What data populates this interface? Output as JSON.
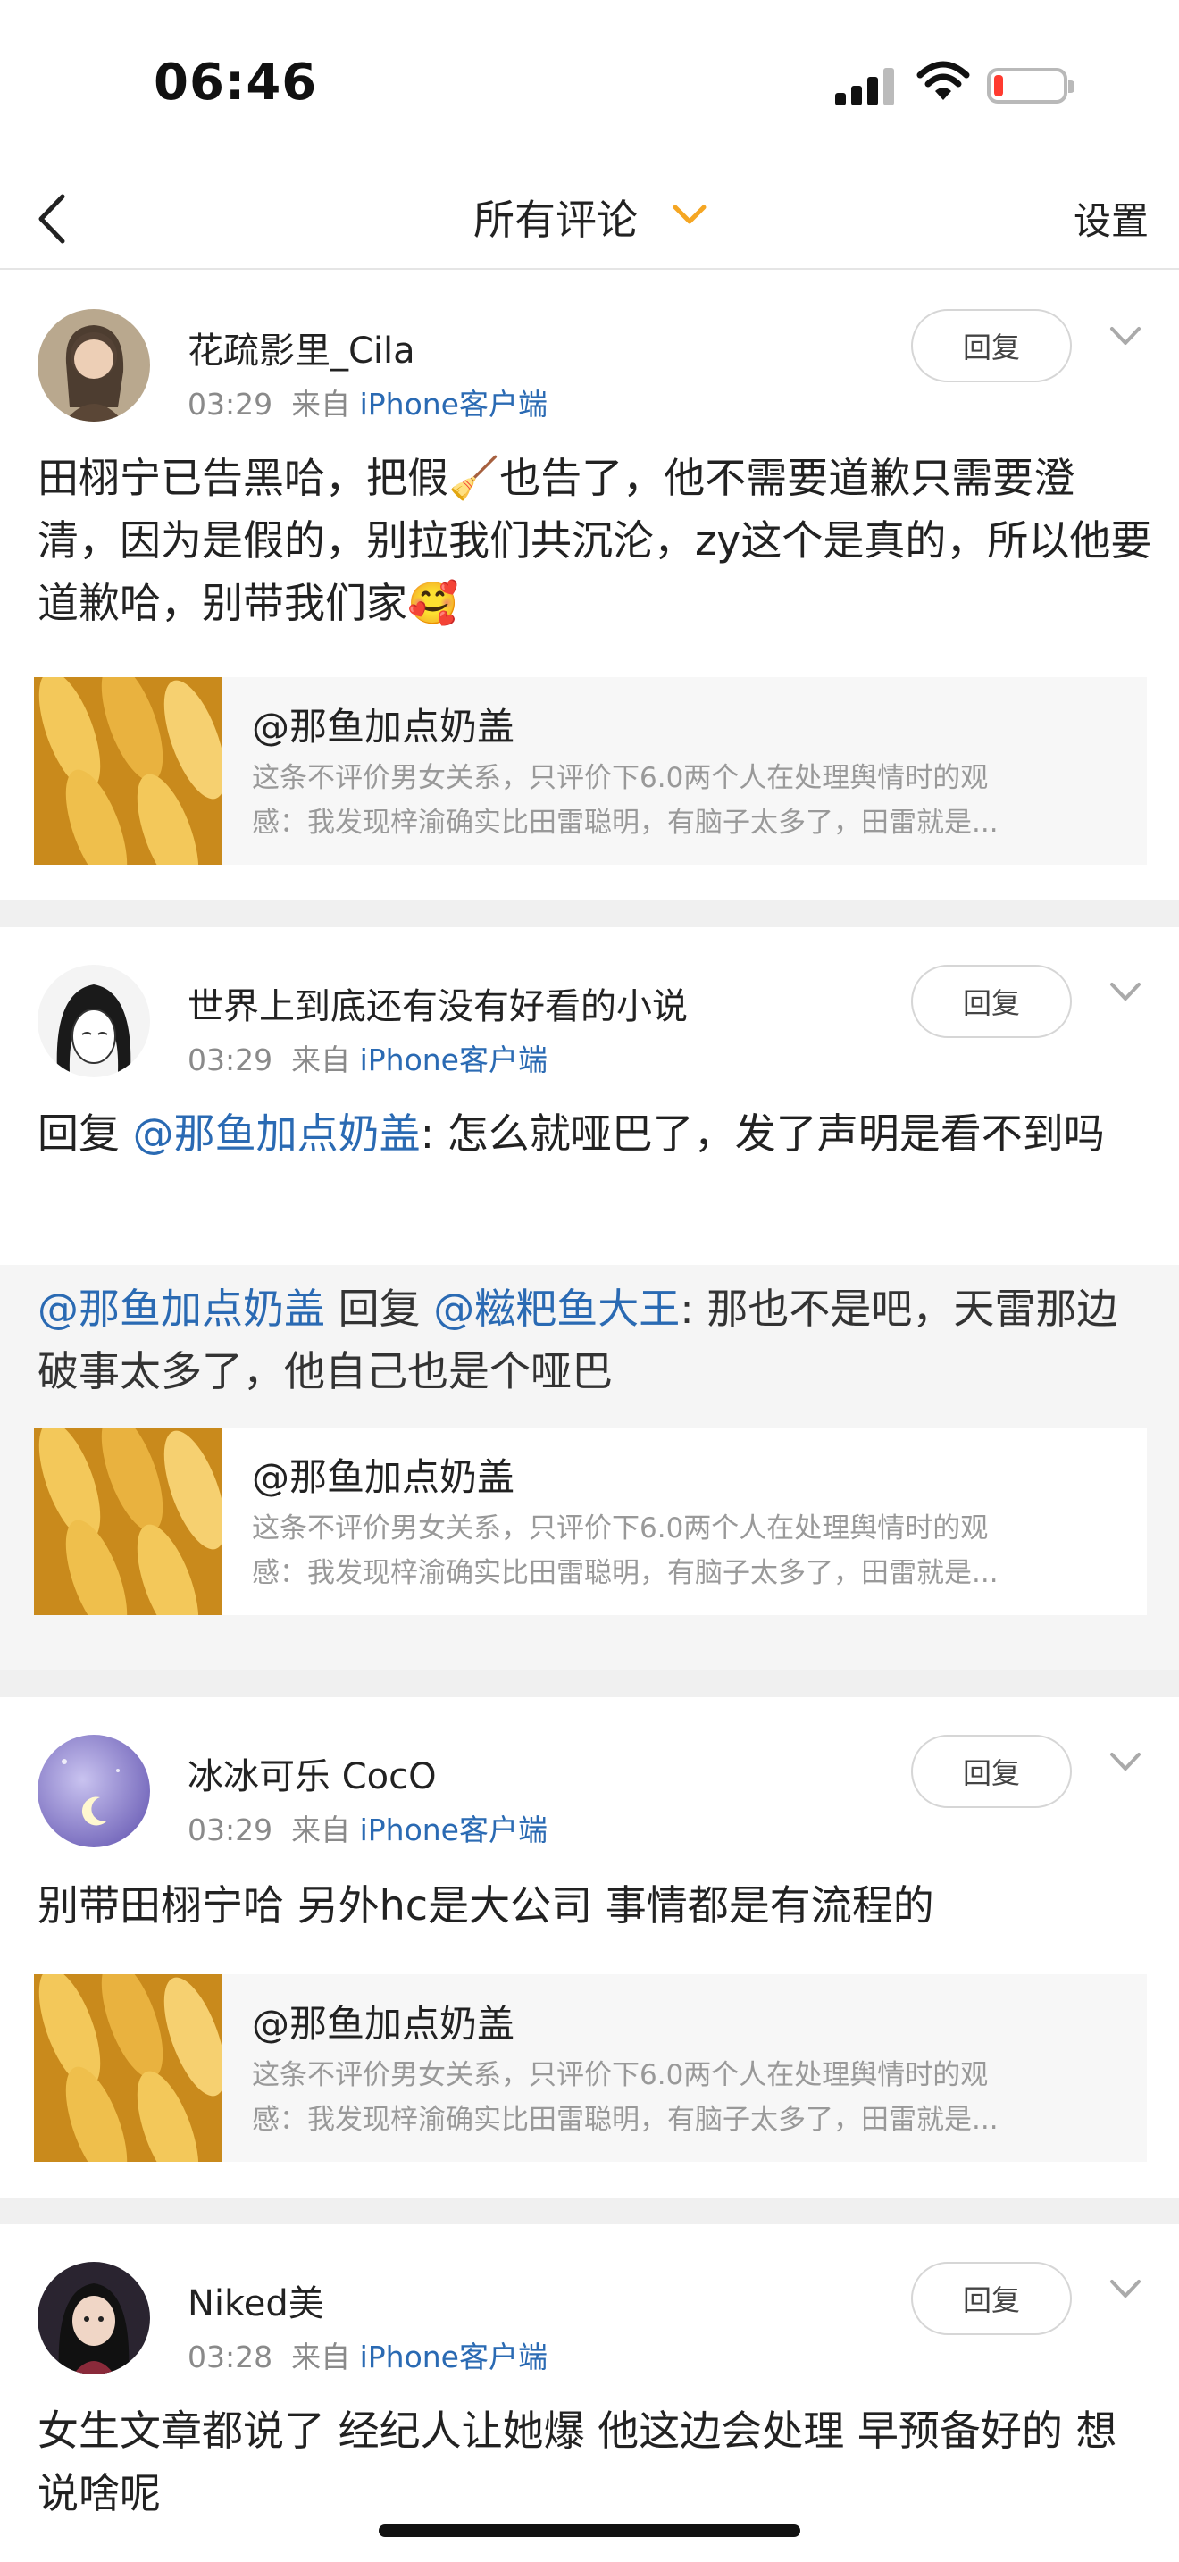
{
  "status_bar": {
    "time": "06:46",
    "battery_color": "#ff3b30"
  },
  "nav": {
    "back_icon": "chevron-left-icon",
    "title": "所有评论",
    "dropdown_icon": "chevron-down-icon",
    "dropdown_color": "#f5a623",
    "settings_label": "设置"
  },
  "comments": [
    {
      "username": "花疏影里_Cila",
      "time": "03:29",
      "from_label": "来自",
      "source": "iPhone客户端",
      "reply_label": "回复",
      "text": "田栩宁已告黑哈，把假🧹也告了，他不需要道歉只需要澄清，因为是假的，别拉我们共沉沦，zy这个是真的，所以他要道歉哈，别带我们家🥰",
      "card": {
        "title": "@那鱼加点奶盖",
        "summary_line1": "这条不评价男女关系，只评价下6.0两个人在处理舆情时的观",
        "summary_line2": "感：我发现梓渝确实比田雷聪明，有脑子太多了，田雷就是..."
      }
    },
    {
      "username": "世界上到底还有没有好看的小说",
      "time": "03:29",
      "from_label": "来自",
      "source": "iPhone客户端",
      "reply_label": "回复",
      "reply_prefix": "回复",
      "reply_mention": "@那鱼加点奶盖",
      "reply_text": ": 怎么就哑巴了，发了声明是看不到吗",
      "quote_mention1": "@那鱼加点奶盖",
      "quote_mid": " 回复 ",
      "quote_mention2": "@糍粑鱼大王",
      "quote_text": ": 那也不是吧，天雷那边破事太多了，他自己也是个哑巴",
      "card": {
        "title": "@那鱼加点奶盖",
        "summary_line1": "这条不评价男女关系，只评价下6.0两个人在处理舆情时的观",
        "summary_line2": "感：我发现梓渝确实比田雷聪明，有脑子太多了，田雷就是..."
      }
    },
    {
      "username": "冰冰可乐 CocO",
      "time": "03:29",
      "from_label": "来自",
      "source": "iPhone客户端",
      "reply_label": "回复",
      "text": "别带田栩宁哈 另外hc是大公司 事情都是有流程的",
      "card": {
        "title": "@那鱼加点奶盖",
        "summary_line1": "这条不评价男女关系，只评价下6.0两个人在处理舆情时的观",
        "summary_line2": "感：我发现梓渝确实比田雷聪明，有脑子太多了，田雷就是..."
      }
    },
    {
      "username": "Niked美",
      "time": "03:28",
      "from_label": "来自",
      "source": "iPhone客户端",
      "reply_label": "回复",
      "text": "女生文章都说了 经纪人让她爆 他这边会处理 早预备好的 想说啥呢"
    }
  ]
}
